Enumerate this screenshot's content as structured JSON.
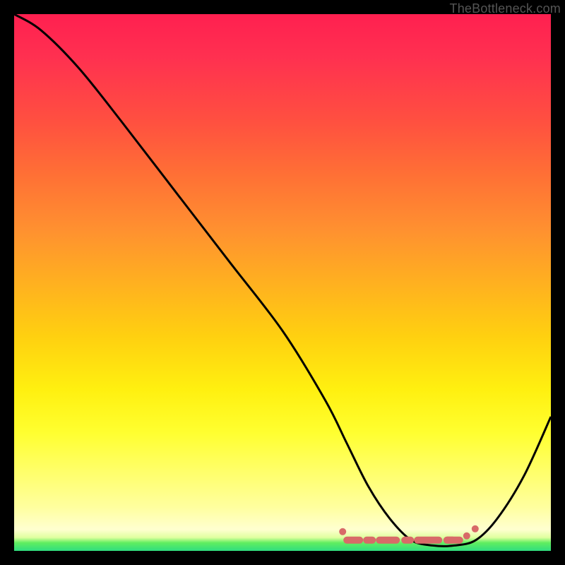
{
  "watermark": "TheBottleneck.com",
  "chart_data": {
    "type": "line",
    "title": "",
    "xlabel": "",
    "ylabel": "",
    "xlim": [
      0,
      100
    ],
    "ylim": [
      0,
      100
    ],
    "series": [
      {
        "name": "bottleneck-curve",
        "x": [
          0,
          5,
          12,
          20,
          30,
          40,
          50,
          58,
          62,
          66,
          70,
          74,
          78,
          82,
          86,
          90,
          95,
          100
        ],
        "y": [
          100,
          97,
          90,
          80,
          67,
          54,
          41,
          28,
          20,
          12,
          6,
          2,
          1,
          1,
          2,
          6,
          14,
          25
        ]
      }
    ],
    "band": {
      "name": "low-bottleneck-zone",
      "x_start": 62,
      "x_end": 83,
      "y": 2
    },
    "colors": {
      "curve": "#000000",
      "band": "#d86a68",
      "gradient_top": "#ff2050",
      "gradient_bottom": "#30dd80"
    }
  }
}
